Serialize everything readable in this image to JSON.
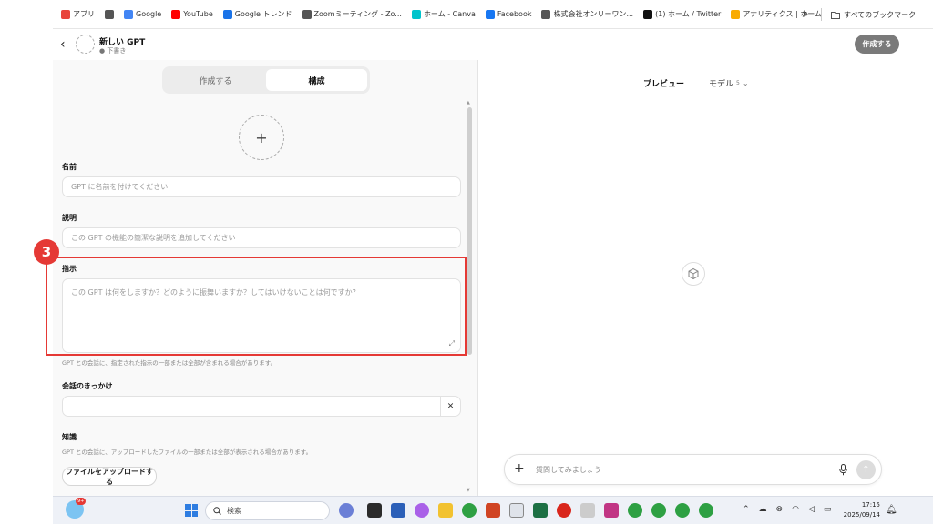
{
  "bookmarks": {
    "items": [
      {
        "label": "アプリ",
        "icon": "apps-grid-icon",
        "color": "#e8453c"
      },
      {
        "label": "",
        "icon": "tab-groups-icon",
        "color": "#555555"
      },
      {
        "label": "Google",
        "icon": "google-icon",
        "color": "#4285f4"
      },
      {
        "label": "YouTube",
        "icon": "youtube-icon",
        "color": "#ff0000"
      },
      {
        "label": "Google トレンド",
        "icon": "trends-icon",
        "color": "#1a73e8"
      },
      {
        "label": "Zoomミーティング - Zo...",
        "icon": "globe-icon",
        "color": "#555555"
      },
      {
        "label": "ホーム - Canva",
        "icon": "canva-icon",
        "color": "#00c4cc"
      },
      {
        "label": "Facebook",
        "icon": "facebook-icon",
        "color": "#1877f2"
      },
      {
        "label": "株式会社オンリーワン...",
        "icon": "globe-icon",
        "color": "#555555"
      },
      {
        "label": "(1) ホーム / Twitter",
        "icon": "x-icon",
        "color": "#111111"
      },
      {
        "label": "アナリティクス | ホーム",
        "icon": "analytics-icon",
        "color": "#f9ab00"
      }
    ],
    "more": "»",
    "all_bookmarks": "すべてのブックマーク"
  },
  "header": {
    "title": "新しい GPT",
    "status": "● 下書き",
    "create_button": "作成する"
  },
  "tabs": [
    {
      "label": "作成する",
      "active": false
    },
    {
      "label": "構成",
      "active": true
    }
  ],
  "form": {
    "name_label": "名前",
    "name_placeholder": "GPT に名前を付けてください",
    "description_label": "説明",
    "description_placeholder": "この GPT の機能の簡潔な説明を追加してください",
    "instructions_label": "指示",
    "instructions_placeholder": "この GPT は何をしますか？どのように振舞いますか？してはいけないことは何ですか？",
    "instructions_hint": "GPT との会話に、指定された指示の一部または全部が含まれる場合があります。",
    "conversation_starters_label": "会話のきっかけ",
    "knowledge_label": "知識",
    "knowledge_hint": "GPT との会話に、アップロードしたファイルの一部または全部が表示される場合があります。",
    "upload_button": "ファイルをアップロードする"
  },
  "annotation": {
    "number": "3",
    "color": "#e53935"
  },
  "preview": {
    "title": "プレビュー",
    "model_label": "モデル",
    "model_version": "5",
    "composer_placeholder": "質問してみましょう"
  },
  "taskbar": {
    "notification_count": "9+",
    "search_label": "検索",
    "time": "17:15",
    "date": "2025/09/14"
  }
}
